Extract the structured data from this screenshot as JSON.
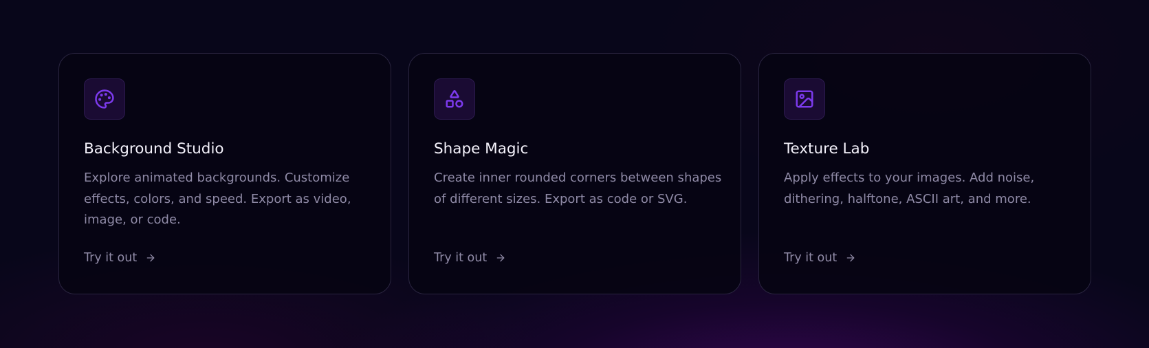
{
  "accent_color": "#7c3aed",
  "cards": [
    {
      "icon": "palette-icon",
      "title": "Background Studio",
      "description": "Explore animated backgrounds. Customize effects, colors, and speed. Export as video, image, or code.",
      "link_label": "Try it out"
    },
    {
      "icon": "shapes-icon",
      "title": "Shape Magic",
      "description": "Create inner rounded corners between shapes of different sizes. Export as code or SVG.",
      "link_label": "Try it out"
    },
    {
      "icon": "image-icon",
      "title": "Texture Lab",
      "description": "Apply effects to your images. Add noise, dithering, halftone, ASCII art, and more.",
      "link_label": "Try it out"
    }
  ]
}
